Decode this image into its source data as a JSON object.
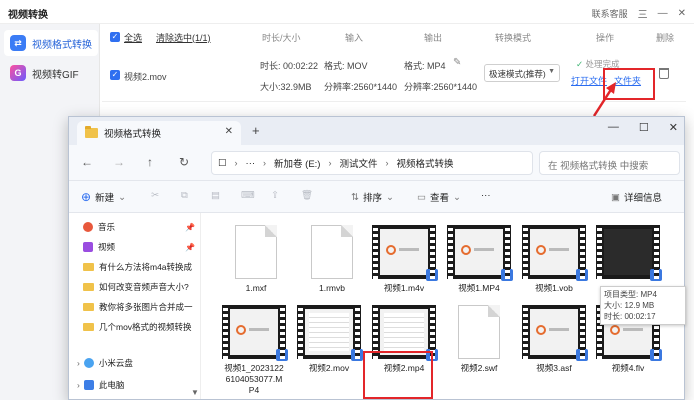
{
  "app": {
    "title": "视频转换",
    "top_right": {
      "left_link": "联系客服",
      "min": "—",
      "close": "✕",
      "menu": "三"
    },
    "sidebar": [
      {
        "label": "视频格式转换",
        "icon": "⇄",
        "active": true
      },
      {
        "label": "视频转GIF",
        "icon": "G",
        "active": false
      }
    ],
    "table_head": {
      "select_all": "全选",
      "clear_selected": "清除选中(1/1)",
      "cols": [
        "时长/大小",
        "输入",
        "输出",
        "转换模式",
        "操作",
        "删除"
      ]
    },
    "row": {
      "name": "视频2.mov",
      "duration": "时长: 00:02:22",
      "size": "大小:32.9MB",
      "in_format": "格式: MOV",
      "in_res": "分辨率:2560*1440",
      "out_format": "格式: MP4",
      "out_res": "分辨率:2560*1440",
      "mode": "极速模式(推荐)",
      "status": "处理完成",
      "open_file": "打开文件",
      "open_folder": "文件夹"
    }
  },
  "explorer": {
    "tab_title": "视频格式转换",
    "new_tab": "+",
    "window_controls": [
      "—",
      "☐",
      "✕"
    ],
    "nav_buttons": [
      "←",
      "→",
      "↑",
      "↻"
    ],
    "address": {
      "root_icon": "☐",
      "more": "···",
      "crumbs": [
        "新加卷 (E:)",
        "测试文件",
        "视频格式转换"
      ]
    },
    "search_placeholder": "在 视频格式转换 中搜索",
    "commands": {
      "new": "新建",
      "sort": "排序",
      "view": "查看",
      "more": "···",
      "details": "详细信息"
    },
    "nav_items": [
      {
        "label": "音乐",
        "kind": "music",
        "pinned": true
      },
      {
        "label": "视频",
        "kind": "video",
        "pinned": true
      },
      {
        "label": "有什么方法将m4a转换成",
        "kind": "folder",
        "pinned": false
      },
      {
        "label": "如何改变音频声音大小?",
        "kind": "folder",
        "pinned": false
      },
      {
        "label": "教你将多张图片合并成一",
        "kind": "folder",
        "pinned": false
      },
      {
        "label": "几个mov格式的视频转换",
        "kind": "folder",
        "pinned": false
      },
      {
        "label": "小米云盘",
        "kind": "cloud",
        "pinned": false
      },
      {
        "label": "此电脑",
        "kind": "pc",
        "pinned": false
      }
    ],
    "files": [
      {
        "name": "1.mxf",
        "kind": "doc"
      },
      {
        "name": "1.rmvb",
        "kind": "doc"
      },
      {
        "name": "视频1.m4v",
        "kind": "film"
      },
      {
        "name": "视频1.MP4",
        "kind": "film"
      },
      {
        "name": "视频1.vob",
        "kind": "film"
      },
      {
        "name": "",
        "kind": "film"
      },
      {
        "name": "视频1_20231226104053077.MP4",
        "kind": "film"
      },
      {
        "name": "视频2.mov",
        "kind": "film"
      },
      {
        "name": "视频2.mp4",
        "kind": "film"
      },
      {
        "name": "视频2.swf",
        "kind": "doc"
      },
      {
        "name": "视频3.asf",
        "kind": "film"
      },
      {
        "name": "视频4.flv",
        "kind": "film"
      }
    ],
    "tooltip": [
      "项目类型: MP4",
      "大小: 12.9 MB",
      "时长: 00:02:17"
    ]
  },
  "colors": {
    "accent": "#2f6ff0",
    "highlight_box": "#e3262a",
    "folder": "#f0c24a"
  }
}
